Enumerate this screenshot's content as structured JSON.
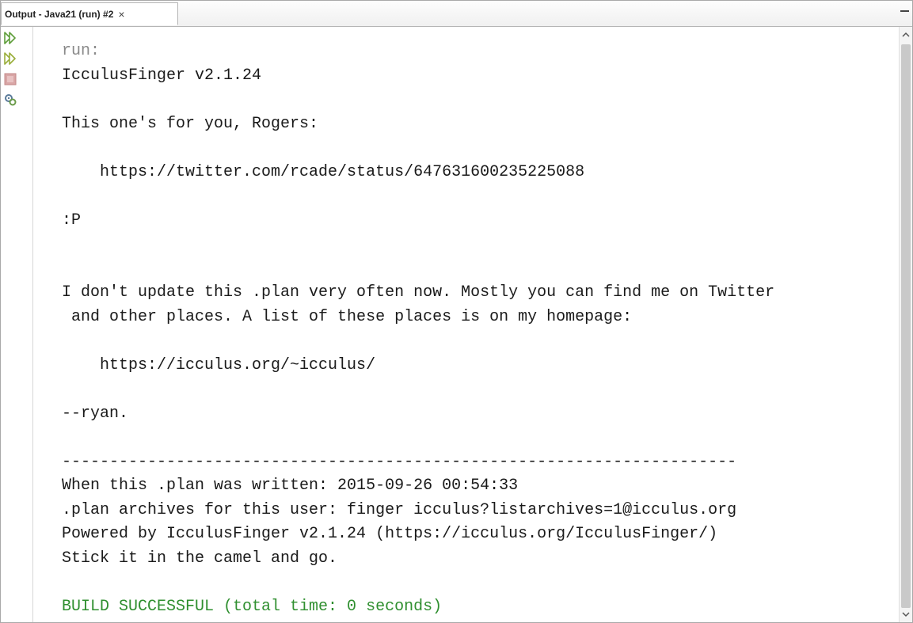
{
  "tab": {
    "title": "Output - Java21 (run) #2",
    "close_glyph": "×"
  },
  "toolbar": {
    "rerun_icon": "rerun-icon",
    "rerun_different_icon": "rerun-with-different-parameters-icon",
    "stop_icon": "stop-icon",
    "settings_icon": "running-process-settings-icon"
  },
  "output": {
    "lines": [
      {
        "text": "run:",
        "style": "muted"
      },
      {
        "text": "IcculusFinger v2.1.24",
        "style": "normal"
      },
      {
        "text": "",
        "style": "normal"
      },
      {
        "text": "This one's for you, Rogers:",
        "style": "normal"
      },
      {
        "text": "",
        "style": "normal"
      },
      {
        "text": "    https://twitter.com/rcade/status/647631600235225088",
        "style": "normal"
      },
      {
        "text": "",
        "style": "normal"
      },
      {
        "text": ":P",
        "style": "normal"
      },
      {
        "text": "",
        "style": "normal"
      },
      {
        "text": "",
        "style": "normal"
      },
      {
        "text": "I don't update this .plan very often now. Mostly you can find me on Twitter",
        "style": "normal"
      },
      {
        "text": " and other places. A list of these places is on my homepage:",
        "style": "normal"
      },
      {
        "text": "",
        "style": "normal"
      },
      {
        "text": "    https://icculus.org/~icculus/",
        "style": "normal"
      },
      {
        "text": "",
        "style": "normal"
      },
      {
        "text": "--ryan.",
        "style": "normal"
      },
      {
        "text": "",
        "style": "normal"
      },
      {
        "text": "-----------------------------------------------------------------------",
        "style": "normal"
      },
      {
        "text": "When this .plan was written: 2015-09-26 00:54:33",
        "style": "normal"
      },
      {
        "text": ".plan archives for this user: finger icculus?listarchives=1@icculus.org",
        "style": "normal"
      },
      {
        "text": "Powered by IcculusFinger v2.1.24 (https://icculus.org/IcculusFinger/)",
        "style": "normal"
      },
      {
        "text": "Stick it in the camel and go.",
        "style": "normal"
      },
      {
        "text": "",
        "style": "normal"
      },
      {
        "text": "BUILD SUCCESSFUL (total time: 0 seconds)",
        "style": "success"
      }
    ]
  },
  "colors": {
    "muted": "#8a8a8a",
    "text": "#1a1a1a",
    "success": "#2f8f2f",
    "rerun_icon": "#6aa84f"
  }
}
